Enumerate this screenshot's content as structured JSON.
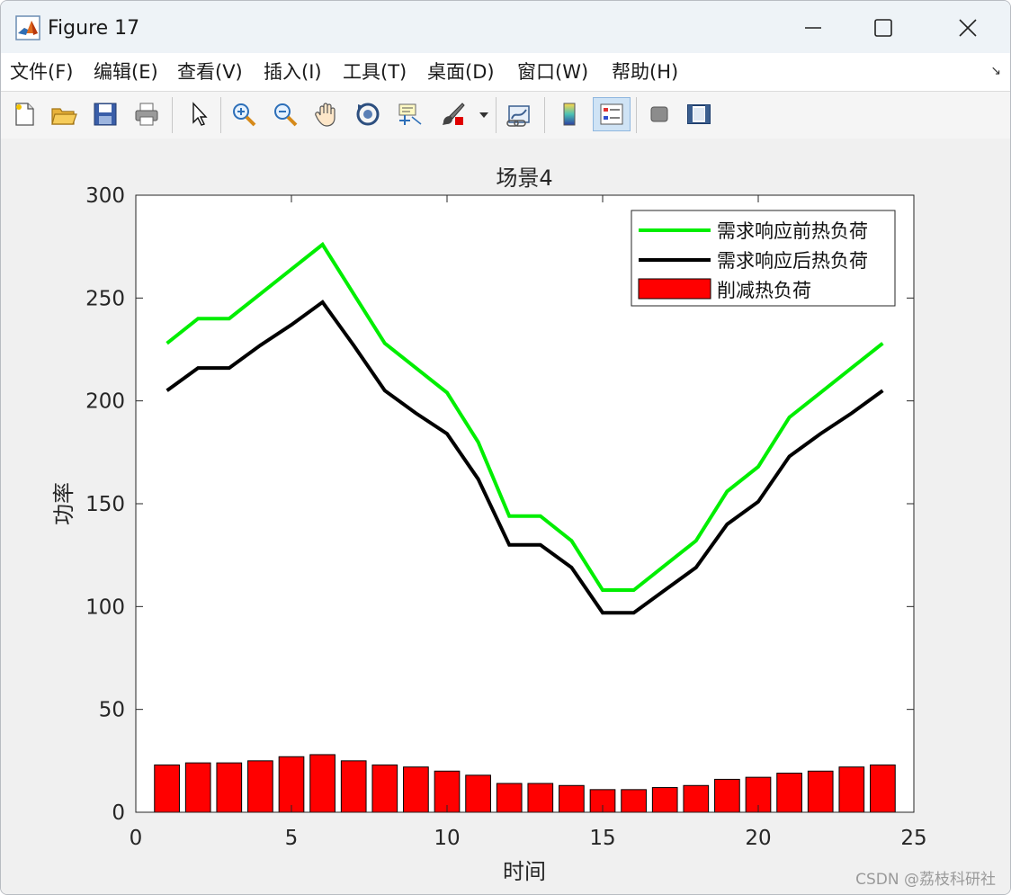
{
  "window": {
    "title": "Figure 17",
    "controls": {
      "minimize": "—",
      "maximize": "☐",
      "close": "✕"
    }
  },
  "menu": {
    "items": [
      {
        "label": "文件(F)",
        "name": "menu-file"
      },
      {
        "label": "编辑(E)",
        "name": "menu-edit"
      },
      {
        "label": "查看(V)",
        "name": "menu-view"
      },
      {
        "label": "插入(I)",
        "name": "menu-insert"
      },
      {
        "label": "工具(T)",
        "name": "menu-tools"
      },
      {
        "label": "桌面(D)",
        "name": "menu-desktop"
      },
      {
        "label": "窗口(W)",
        "name": "menu-window"
      },
      {
        "label": "帮助(H)",
        "name": "menu-help"
      }
    ],
    "dock_arrow": "↘"
  },
  "toolbar": {
    "buttons": [
      "new-figure",
      "open-file",
      "save",
      "print",
      "pointer",
      "zoom-in",
      "zoom-out",
      "pan",
      "rotate-3d",
      "data-cursor",
      "brush",
      "link-plot",
      "colorbar",
      "legend",
      "hide-plot-tools",
      "show-plot-tools"
    ],
    "active": "legend"
  },
  "chart_data": {
    "type": "line",
    "title": "场景4",
    "xlabel": "时间",
    "ylabel": "功率",
    "xlim": [
      0,
      25
    ],
    "ylim": [
      0,
      300
    ],
    "xticks": [
      0,
      5,
      10,
      15,
      20,
      25
    ],
    "yticks": [
      0,
      50,
      100,
      150,
      200,
      250,
      300
    ],
    "grid": false,
    "legend_position": "top-right",
    "x": [
      1,
      2,
      3,
      4,
      5,
      6,
      7,
      8,
      9,
      10,
      11,
      12,
      13,
      14,
      15,
      16,
      17,
      18,
      19,
      20,
      21,
      22,
      23,
      24
    ],
    "series": [
      {
        "name": "需求响应前热负荷",
        "type": "line",
        "color": "#00ee00",
        "values": [
          228,
          240,
          240,
          252,
          264,
          276,
          252,
          228,
          216,
          204,
          180,
          144,
          144,
          132,
          108,
          108,
          120,
          132,
          156,
          168,
          192,
          204,
          216,
          228
        ]
      },
      {
        "name": "需求响应后热负荷",
        "type": "line",
        "color": "#000000",
        "values": [
          205,
          216,
          216,
          227,
          237,
          248,
          227,
          205,
          194,
          184,
          162,
          130,
          130,
          119,
          97,
          97,
          108,
          119,
          140,
          151,
          173,
          184,
          194,
          205
        ]
      },
      {
        "name": "削减热负荷",
        "type": "bar",
        "color": "#ff0000",
        "values": [
          23,
          24,
          24,
          25,
          27,
          28,
          25,
          23,
          22,
          20,
          18,
          14,
          14,
          13,
          11,
          11,
          12,
          13,
          16,
          17,
          19,
          20,
          22,
          23
        ]
      }
    ]
  },
  "watermark": "CSDN @荔枝科研社"
}
